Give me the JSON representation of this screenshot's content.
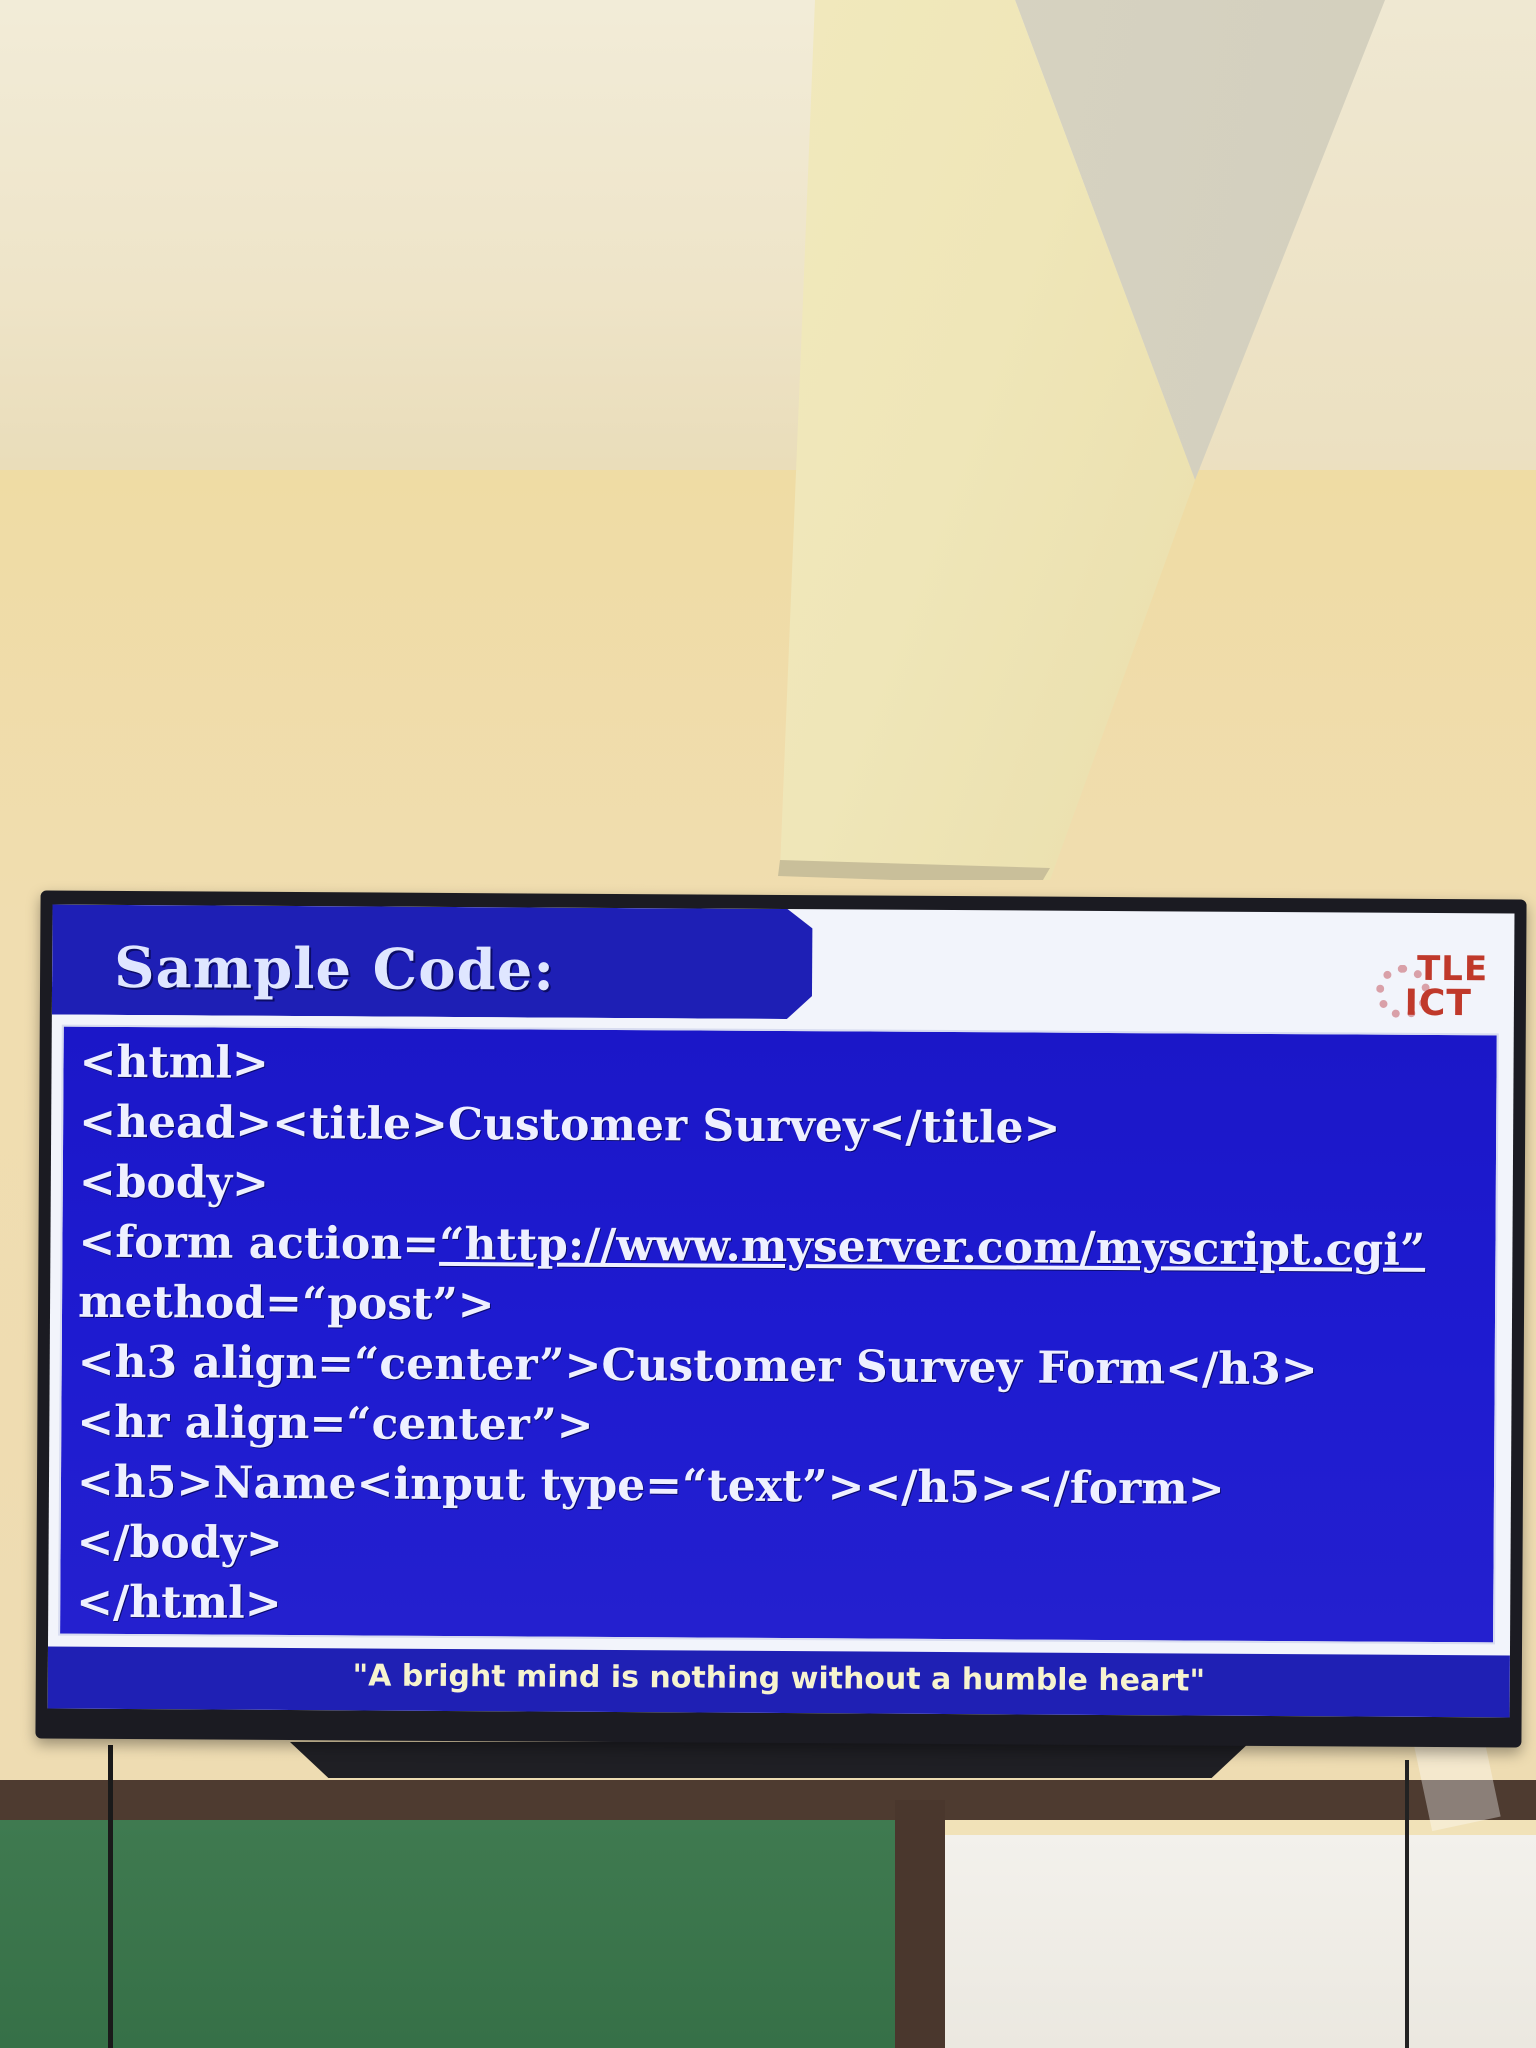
{
  "slide": {
    "title": "Sample Code:",
    "logo": {
      "line1": "TLE",
      "line2": "ICT"
    },
    "code_lines": [
      "<html>",
      "<head><title>Customer Survey</title>",
      "<body>",
      "<form  action=",
      "method=“post”>",
      "<h3 align=“center”>Customer Survey Form</h3>",
      "<hr align=“center”>",
      "<h5>Name<input type=“text”></h5></form>",
      "</body>",
      "</html>"
    ],
    "form_action_url": "“http://www.myserver.com/myscript.cgi”",
    "footer_quote": "\"A bright mind is nothing without a humble heart\""
  }
}
